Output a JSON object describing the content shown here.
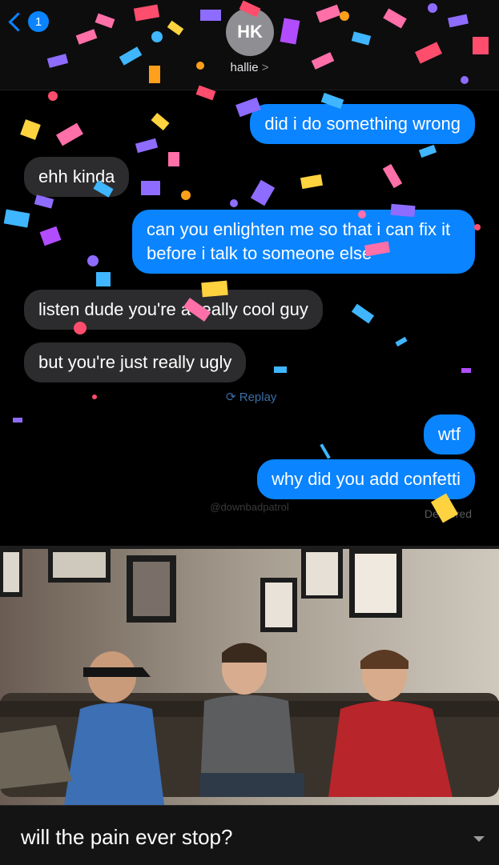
{
  "header": {
    "back_badge": "1",
    "avatar_initials": "HK",
    "contact_name": "hallie",
    "contact_chevron": ">"
  },
  "messages": [
    {
      "sender": "me",
      "text": "did i do something wrong"
    },
    {
      "sender": "them",
      "text": "ehh kinda"
    },
    {
      "sender": "me",
      "text": "can you enlighten me so that i can fix it before i talk to someone else"
    },
    {
      "sender": "them",
      "text": "listen dude you're a really cool guy"
    },
    {
      "sender": "them",
      "text": "but you're just really ugly"
    },
    {
      "sender": "me",
      "text": "wtf"
    },
    {
      "sender": "me",
      "text": "why did you add confetti"
    }
  ],
  "replay_label": "⟳ Replay",
  "watermark": "@downbadpatrol",
  "delivery_status": "Delivered",
  "caption": "will the pain ever stop?",
  "icons": {
    "back": "chevron-left-icon",
    "contact": "chevron-right-icon",
    "replay": "replay-icon",
    "caption": "chevron-down-icon"
  },
  "colors": {
    "outgoing_bubble": "#0a84ff",
    "incoming_bubble": "#2c2c2e",
    "background": "#000000"
  }
}
